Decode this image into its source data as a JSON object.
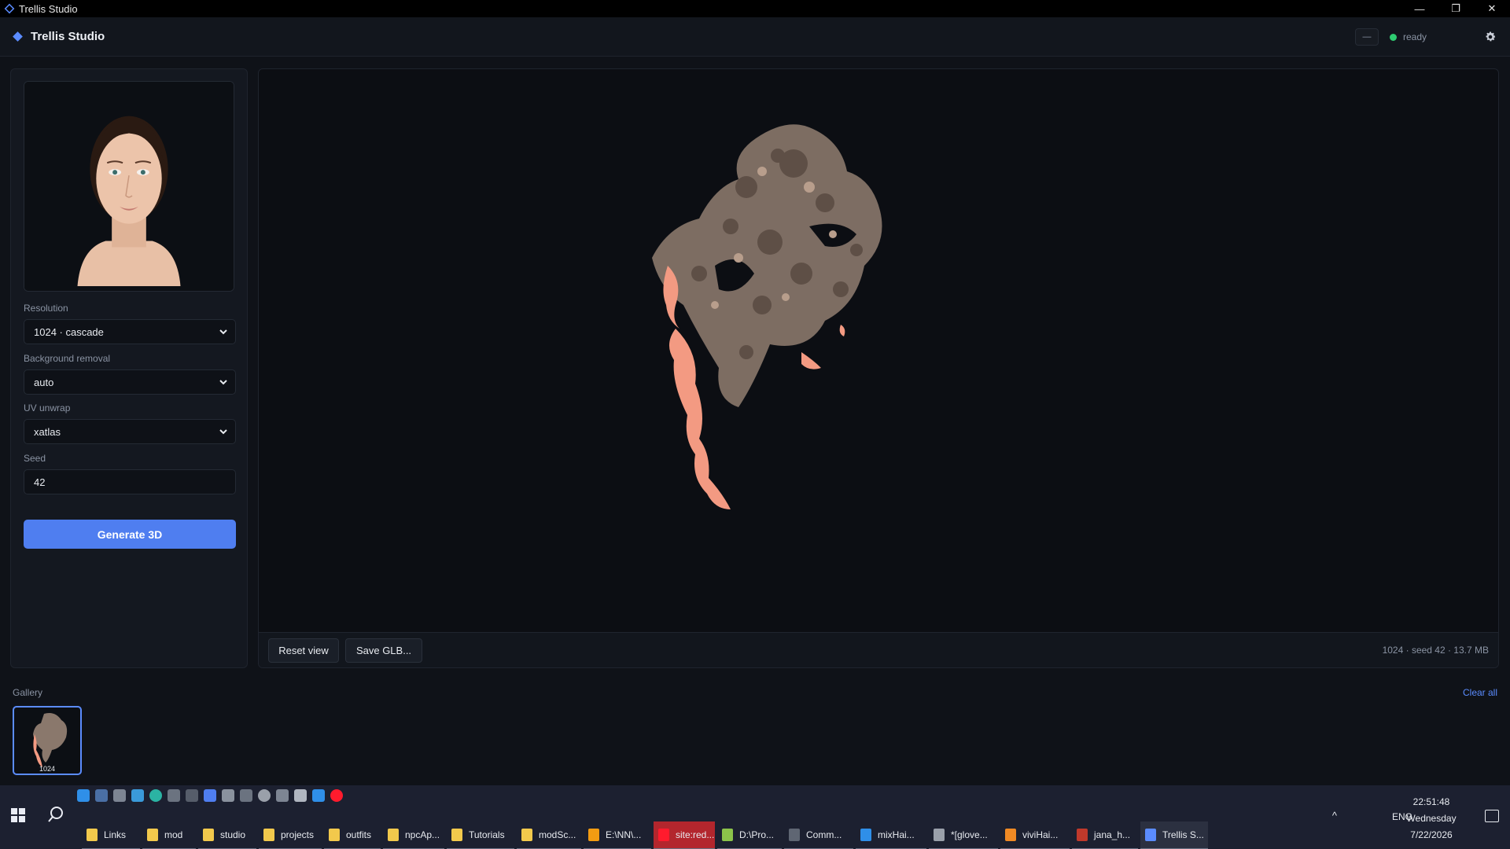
{
  "window": {
    "title": "Trellis Studio",
    "minimize": "—",
    "restore": "❐",
    "close": "✕"
  },
  "header": {
    "brand": "Trellis Studio",
    "mini_button": "—",
    "status": "ready",
    "settings_icon": "gear-icon"
  },
  "controls": {
    "resolution": {
      "label": "Resolution",
      "value": "1024 · cascade"
    },
    "background_removal": {
      "label": "Background removal",
      "value": "auto"
    },
    "uv_unwrap": {
      "label": "UV unwrap",
      "value": "xatlas"
    },
    "seed": {
      "label": "Seed",
      "value": "42"
    },
    "generate_label": "Generate 3D"
  },
  "viewport": {
    "reset_label": "Reset view",
    "save_label": "Save GLB...",
    "info": "1024 · seed 42 · 13.7 MB"
  },
  "gallery": {
    "label": "Gallery",
    "clear_label": "Clear all",
    "items": [
      {
        "label": "1024"
      }
    ]
  },
  "taskbar": {
    "items": [
      {
        "label": "Links",
        "icon": "folder-icon",
        "color": "#f2c94c"
      },
      {
        "label": "mod",
        "icon": "folder-icon",
        "color": "#f2c94c"
      },
      {
        "label": "studio",
        "icon": "folder-icon",
        "color": "#f2c94c"
      },
      {
        "label": "projects",
        "icon": "folder-icon",
        "color": "#f2c94c"
      },
      {
        "label": "outfits",
        "icon": "folder-icon",
        "color": "#f2c94c"
      },
      {
        "label": "npcAp...",
        "icon": "folder-icon",
        "color": "#f2c94c"
      },
      {
        "label": "Tutorials",
        "icon": "folder-icon",
        "color": "#f2c94c"
      },
      {
        "label": "modSc...",
        "icon": "folder-icon",
        "color": "#f2c94c"
      },
      {
        "label": "E:\\NN\\...",
        "icon": "app-icon",
        "color": "#f39c12"
      },
      {
        "label": "site:red...",
        "icon": "opera-icon",
        "color": "#ff1b2d"
      },
      {
        "label": "D:\\Pro...",
        "icon": "notepad-icon",
        "color": "#8bc34a"
      },
      {
        "label": "Comm...",
        "icon": "terminal-icon",
        "color": "#5f6673"
      },
      {
        "label": "mixHai...",
        "icon": "vscode-icon",
        "color": "#2f8fe8"
      },
      {
        "label": "*[glove...",
        "icon": "app-icon",
        "color": "#9aa0aa"
      },
      {
        "label": "viviHai...",
        "icon": "blender-icon",
        "color": "#f08a24"
      },
      {
        "label": "jana_h...",
        "icon": "app-icon",
        "color": "#c0392b"
      },
      {
        "label": "Trellis S...",
        "icon": "trellis-icon",
        "color": "#5b8cff"
      }
    ],
    "language": "ENG",
    "time": "22:51:48",
    "day": "Wednesday",
    "date": "7/22/2026"
  }
}
